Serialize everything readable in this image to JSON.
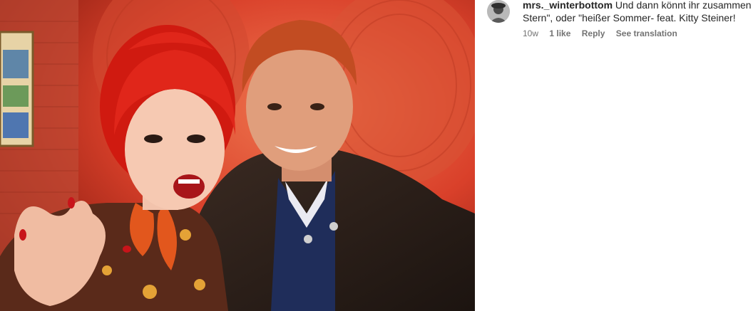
{
  "post": {
    "image_alt_semantic": "photo"
  },
  "comment": {
    "username": "mrs._winterbottom",
    "text_line1": "Und dann könnt ihr zusammen \"",
    "text_line2": "Stern\", oder \"heißer Sommer- feat. Kitty Steiner!",
    "time_ago": "10w",
    "likes": "1 like",
    "reply_label": "Reply",
    "translation_label": "See translation"
  }
}
